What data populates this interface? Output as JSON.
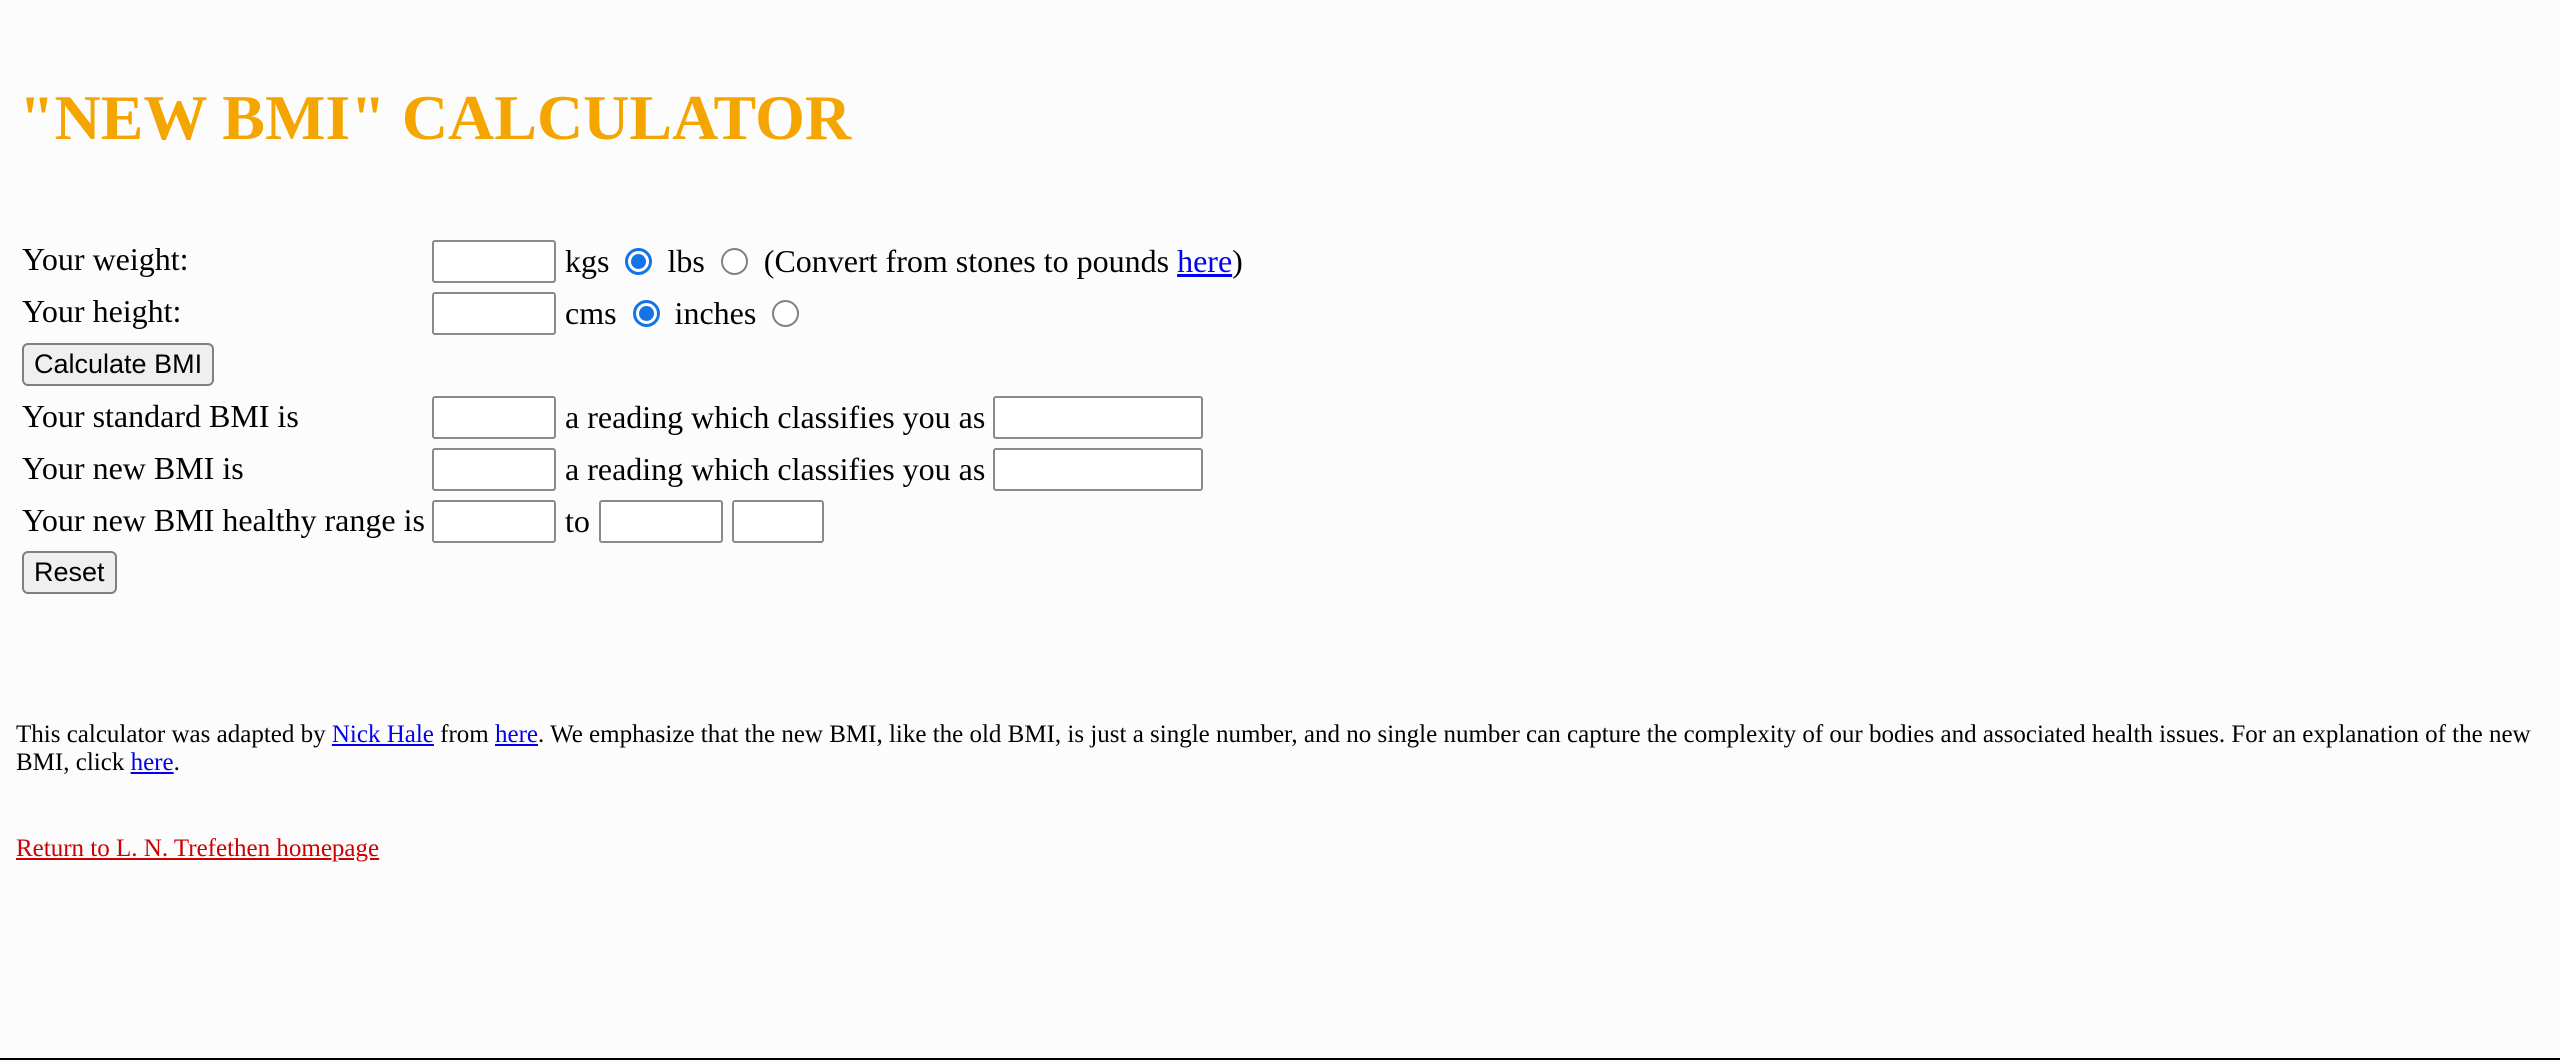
{
  "title": "\"NEW BMI\" CALCULATOR",
  "weight": {
    "label": "Your weight:",
    "value": "",
    "unit_kgs": "kgs",
    "unit_lbs": "lbs",
    "selected_unit": "kgs",
    "convert_prefix": "(Convert from stones to pounds ",
    "convert_link": "here",
    "convert_suffix": ")"
  },
  "height": {
    "label": "Your height:",
    "value": "",
    "unit_cms": "cms",
    "unit_inches": "inches",
    "selected_unit": "cms"
  },
  "buttons": {
    "calculate": "Calculate BMI",
    "reset": "Reset"
  },
  "results": {
    "standard_label": "Your standard BMI is",
    "new_label": "Your new BMI is",
    "classifies_text": "a reading which classifies you as",
    "range_label": "Your new BMI healthy range is",
    "to_text": "to"
  },
  "footer": {
    "t1": "This calculator was adapted by ",
    "link_author": "Nick Hale",
    "t2": " from ",
    "link_here1": "here",
    "t3": ". We emphasize that the new BMI, like the old BMI, is just a single number, and no single number can capture the complexity of our bodies and associated health issues. For an explanation of the new BMI, click ",
    "link_here2": "here",
    "t4": "."
  },
  "home_link": "Return to L. N. Trefethen homepage",
  "colors": {
    "title": "#f5a500",
    "link": "#0000ee",
    "home_link": "#cc0000",
    "radio_selected": "#1473e6"
  }
}
